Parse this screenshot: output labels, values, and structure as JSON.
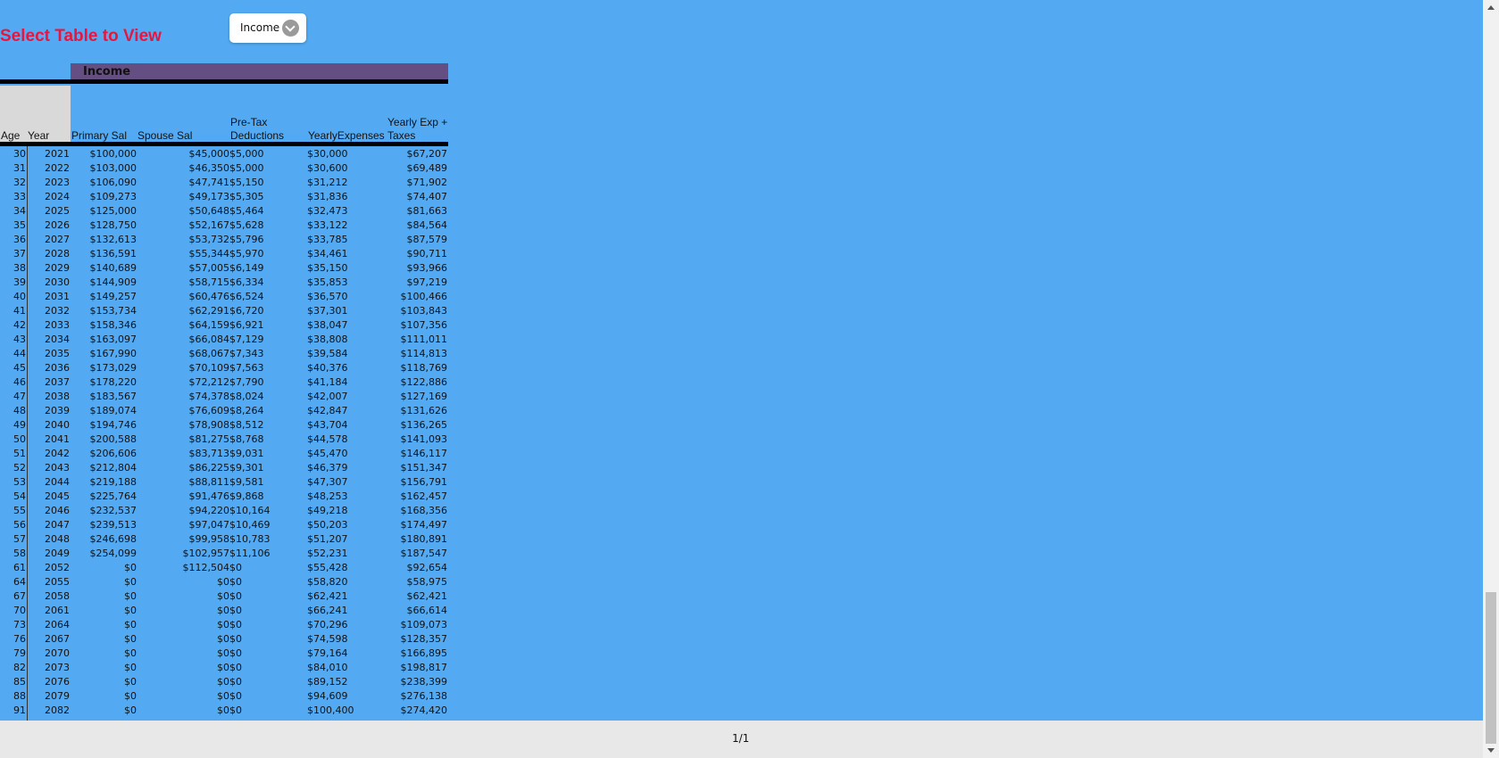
{
  "title": "Select Table to View",
  "table_select": {
    "value": "Income"
  },
  "table_group": "Income",
  "columns": {
    "age": "Age",
    "year": "Year",
    "primary": "Primary Sal",
    "spouse": "Spouse Sal",
    "pretax_1": "Pre-Tax",
    "pretax_2": "Deductions",
    "yearly": "YearlyExpenses",
    "yearly_exp_1": "Yearly Exp +",
    "yearly_exp_2": "Taxes"
  },
  "rows": [
    [
      "30",
      "2021",
      "$100,000",
      "$45,000",
      "$5,000",
      "$30,000",
      "$67,207"
    ],
    [
      "31",
      "2022",
      "$103,000",
      "$46,350",
      "$5,000",
      "$30,600",
      "$69,489"
    ],
    [
      "32",
      "2023",
      "$106,090",
      "$47,741",
      "$5,150",
      "$31,212",
      "$71,902"
    ],
    [
      "33",
      "2024",
      "$109,273",
      "$49,173",
      "$5,305",
      "$31,836",
      "$74,407"
    ],
    [
      "34",
      "2025",
      "$125,000",
      "$50,648",
      "$5,464",
      "$32,473",
      "$81,663"
    ],
    [
      "35",
      "2026",
      "$128,750",
      "$52,167",
      "$5,628",
      "$33,122",
      "$84,564"
    ],
    [
      "36",
      "2027",
      "$132,613",
      "$53,732",
      "$5,796",
      "$33,785",
      "$87,579"
    ],
    [
      "37",
      "2028",
      "$136,591",
      "$55,344",
      "$5,970",
      "$34,461",
      "$90,711"
    ],
    [
      "38",
      "2029",
      "$140,689",
      "$57,005",
      "$6,149",
      "$35,150",
      "$93,966"
    ],
    [
      "39",
      "2030",
      "$144,909",
      "$58,715",
      "$6,334",
      "$35,853",
      "$97,219"
    ],
    [
      "40",
      "2031",
      "$149,257",
      "$60,476",
      "$6,524",
      "$36,570",
      "$100,466"
    ],
    [
      "41",
      "2032",
      "$153,734",
      "$62,291",
      "$6,720",
      "$37,301",
      "$103,843"
    ],
    [
      "42",
      "2033",
      "$158,346",
      "$64,159",
      "$6,921",
      "$38,047",
      "$107,356"
    ],
    [
      "43",
      "2034",
      "$163,097",
      "$66,084",
      "$7,129",
      "$38,808",
      "$111,011"
    ],
    [
      "44",
      "2035",
      "$167,990",
      "$68,067",
      "$7,343",
      "$39,584",
      "$114,813"
    ],
    [
      "45",
      "2036",
      "$173,029",
      "$70,109",
      "$7,563",
      "$40,376",
      "$118,769"
    ],
    [
      "46",
      "2037",
      "$178,220",
      "$72,212",
      "$7,790",
      "$41,184",
      "$122,886"
    ],
    [
      "47",
      "2038",
      "$183,567",
      "$74,378",
      "$8,024",
      "$42,007",
      "$127,169"
    ],
    [
      "48",
      "2039",
      "$189,074",
      "$76,609",
      "$8,264",
      "$42,847",
      "$131,626"
    ],
    [
      "49",
      "2040",
      "$194,746",
      "$78,908",
      "$8,512",
      "$43,704",
      "$136,265"
    ],
    [
      "50",
      "2041",
      "$200,588",
      "$81,275",
      "$8,768",
      "$44,578",
      "$141,093"
    ],
    [
      "51",
      "2042",
      "$206,606",
      "$83,713",
      "$9,031",
      "$45,470",
      "$146,117"
    ],
    [
      "52",
      "2043",
      "$212,804",
      "$86,225",
      "$9,301",
      "$46,379",
      "$151,347"
    ],
    [
      "53",
      "2044",
      "$219,188",
      "$88,811",
      "$9,581",
      "$47,307",
      "$156,791"
    ],
    [
      "54",
      "2045",
      "$225,764",
      "$91,476",
      "$9,868",
      "$48,253",
      "$162,457"
    ],
    [
      "55",
      "2046",
      "$232,537",
      "$94,220",
      "$10,164",
      "$49,218",
      "$168,356"
    ],
    [
      "56",
      "2047",
      "$239,513",
      "$97,047",
      "$10,469",
      "$50,203",
      "$174,497"
    ],
    [
      "57",
      "2048",
      "$246,698",
      "$99,958",
      "$10,783",
      "$51,207",
      "$180,891"
    ],
    [
      "58",
      "2049",
      "$254,099",
      "$102,957",
      "$11,106",
      "$52,231",
      "$187,547"
    ],
    [
      "61",
      "2052",
      "$0",
      "$112,504",
      "$0",
      "$55,428",
      "$92,654"
    ],
    [
      "64",
      "2055",
      "$0",
      "$0",
      "$0",
      "$58,820",
      "$58,975"
    ],
    [
      "67",
      "2058",
      "$0",
      "$0",
      "$0",
      "$62,421",
      "$62,421"
    ],
    [
      "70",
      "2061",
      "$0",
      "$0",
      "$0",
      "$66,241",
      "$66,614"
    ],
    [
      "73",
      "2064",
      "$0",
      "$0",
      "$0",
      "$70,296",
      "$109,073"
    ],
    [
      "76",
      "2067",
      "$0",
      "$0",
      "$0",
      "$74,598",
      "$128,357"
    ],
    [
      "79",
      "2070",
      "$0",
      "$0",
      "$0",
      "$79,164",
      "$166,895"
    ],
    [
      "82",
      "2073",
      "$0",
      "$0",
      "$0",
      "$84,010",
      "$198,817"
    ],
    [
      "85",
      "2076",
      "$0",
      "$0",
      "$0",
      "$89,152",
      "$238,399"
    ],
    [
      "88",
      "2079",
      "$0",
      "$0",
      "$0",
      "$94,609",
      "$276,138"
    ],
    [
      "91",
      "2082",
      "$0",
      "$0",
      "$0",
      "$100,400",
      "$274,420"
    ]
  ],
  "footer": {
    "page_indicator": "1/1"
  }
}
